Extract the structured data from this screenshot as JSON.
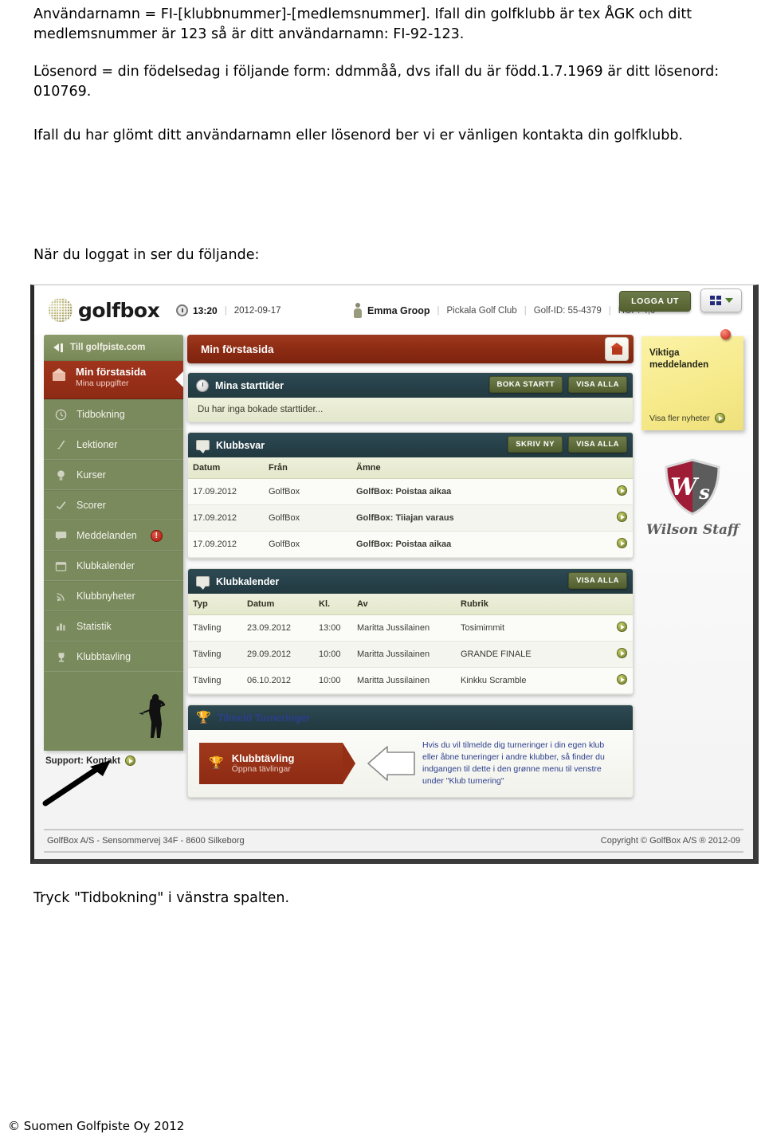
{
  "document": {
    "para1": "Användarnamn = FI-[klubbnummer]-[medlemsnummer]. Ifall din golfklubb är tex ÅGK och ditt medlemsnummer är 123 så är ditt användarnamn: FI-92-123.",
    "para2": "Lösenord = din födelsedag i följande form: ddmmåå, dvs ifall du är född.1.7.1969 är ditt lösenord: 010769.",
    "para3": "Ifall du har glömt ditt användarnamn eller lösenord ber vi er vänligen kontakta din golfklubb.",
    "para4": "När du loggat in ser du följande:",
    "para5": "Tryck \"Tidbokning\" i vänstra spalten.",
    "copyright": "© Suomen Golfpiste Oy 2012"
  },
  "app": {
    "brand": "golfbox",
    "header": {
      "time": "13:20",
      "date": "2012-09-17",
      "user_name": "Emma Groop",
      "club": "Pickala Golf Club",
      "golf_id": "Golf-ID: 55-4379",
      "hcp": "HCP: 4,0",
      "logout_label": "LOGGA UT"
    },
    "sidebar": {
      "back_link": "Till golfpiste.com",
      "active": {
        "label": "Min förstasida",
        "sub": "Mina uppgifter"
      },
      "items": [
        {
          "label": "Tidbokning",
          "icon": "clock-icon",
          "badge": ""
        },
        {
          "label": "Lektioner",
          "icon": "golf-club-icon",
          "badge": ""
        },
        {
          "label": "Kurser",
          "icon": "golf-ball-icon",
          "badge": ""
        },
        {
          "label": "Scorer",
          "icon": "scorecard-icon",
          "badge": ""
        },
        {
          "label": "Meddelanden",
          "icon": "message-icon",
          "badge": "!"
        },
        {
          "label": "Klubkalender",
          "icon": "calendar-icon",
          "badge": ""
        },
        {
          "label": "Klubbnyheter",
          "icon": "rss-icon",
          "badge": ""
        },
        {
          "label": "Statistik",
          "icon": "bar-chart-icon",
          "badge": ""
        },
        {
          "label": "Klubbtavling",
          "icon": "trophy-icon",
          "badge": ""
        }
      ],
      "support": "Support: Kontakt"
    },
    "page_title": "Min förstasida",
    "panels": {
      "starttider": {
        "title": "Mina starttider",
        "btn1": "BOKA STARTT",
        "btn2": "VISA ALLA",
        "empty": "Du har inga bokade starttider..."
      },
      "klubbsvar": {
        "title": "Klubbsvar",
        "btn1": "SKRIV NY",
        "btn2": "VISA ALLA",
        "columns": [
          "Datum",
          "Från",
          "Ämne"
        ],
        "rows": [
          {
            "datum": "17.09.2012",
            "fran": "GolfBox",
            "amne": "GolfBox: Poistaa aikaa"
          },
          {
            "datum": "17.09.2012",
            "fran": "GolfBox",
            "amne": "GolfBox: Tiiajan varaus"
          },
          {
            "datum": "17.09.2012",
            "fran": "GolfBox",
            "amne": "GolfBox: Poistaa aikaa"
          }
        ]
      },
      "klubkalender": {
        "title": "Klubkalender",
        "btn1": "VISA ALLA",
        "columns": [
          "Typ",
          "Datum",
          "Kl.",
          "Av",
          "Rubrik"
        ],
        "rows": [
          {
            "typ": "Tävling",
            "datum": "23.09.2012",
            "kl": "13:00",
            "av": "Maritta Jussilainen",
            "rubrik": "Tosimimmit"
          },
          {
            "typ": "Tävling",
            "datum": "29.09.2012",
            "kl": "10:00",
            "av": "Maritta Jussilainen",
            "rubrik": "GRANDE FINALE"
          },
          {
            "typ": "Tävling",
            "datum": "06.10.2012",
            "kl": "10:00",
            "av": "Maritta Jussilainen",
            "rubrik": "Kinkku Scramble"
          }
        ]
      },
      "turneringer": {
        "title": "Tilmeld Turneringer",
        "tag_line1": "Klubbtävling",
        "tag_line2": "Öppna tävlingar",
        "info": "Hvis du vil tilmelde dig turneringer i din egen klub eller åbne tuneringer i andre klubber, så finder du indgangen til dette i den grønne menu til venstre under \"Klub turnering\""
      }
    },
    "right_rail": {
      "sticky_title": "Viktiga meddelanden",
      "sticky_link": "Visa fler nyheter",
      "sponsor": "Wilson Staff"
    },
    "footer": {
      "left": "GolfBox A/S - Sensommervej 34F - 8600 Silkeborg",
      "right": "Copyright © GolfBox A/S ® 2012-09"
    }
  },
  "colors": {
    "accent_red": "#8d2a12",
    "nav_green": "#7b8a5d",
    "panel_teal": "#27414a",
    "button_olive": "#525e2e",
    "sticky_yellow": "#f6ea8b"
  }
}
